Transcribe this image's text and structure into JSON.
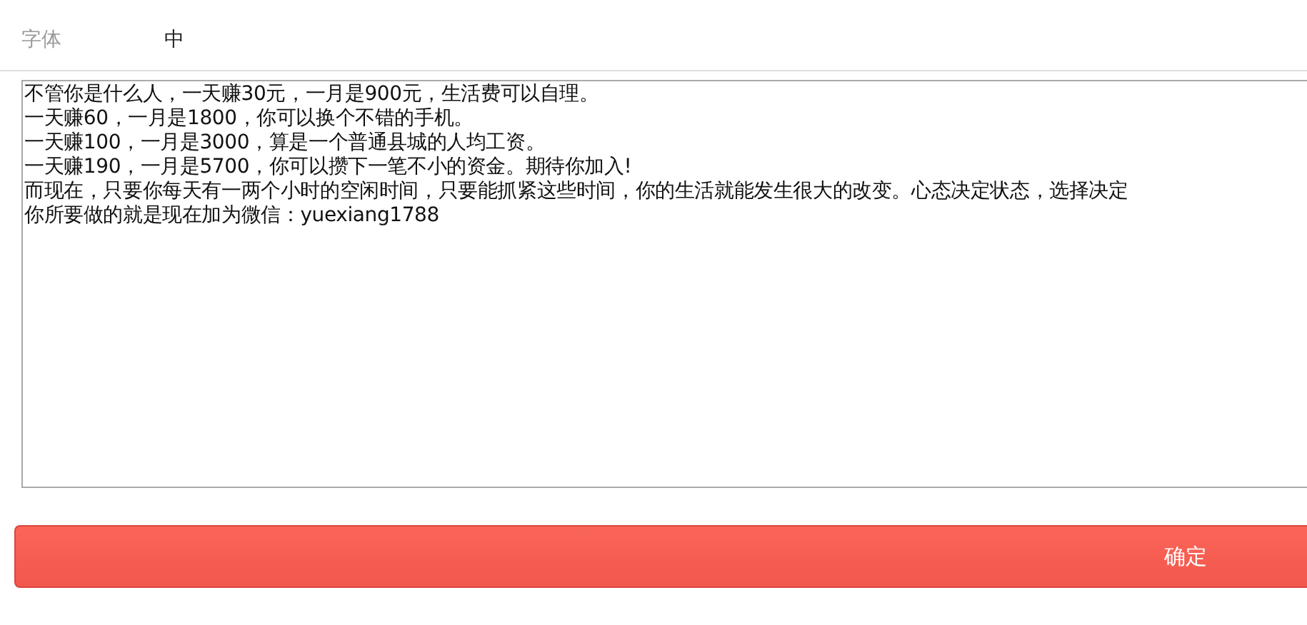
{
  "font_setting": {
    "label": "字体",
    "value": "中"
  },
  "text_area": {
    "lines": [
      "不管你是什么人，一天赚30元，一月是900元，生活费可以自理。",
      "一天赚60，一月是1800，你可以换个不错的手机。",
      "一天赚100，一月是3000，算是一个普通县城的人均工资。",
      "一天赚190，一月是5700，你可以攒下一笔不小的资金。期待你加入!",
      "而现在，只要你每天有一两个小时的空闲时间，只要能抓紧这些时间，你的生活就能发生很大的改变。心态决定状态，选择决定",
      "你所要做的就是现在加为微信：yuexiang1788"
    ]
  },
  "confirm_button": {
    "label": "确定"
  }
}
